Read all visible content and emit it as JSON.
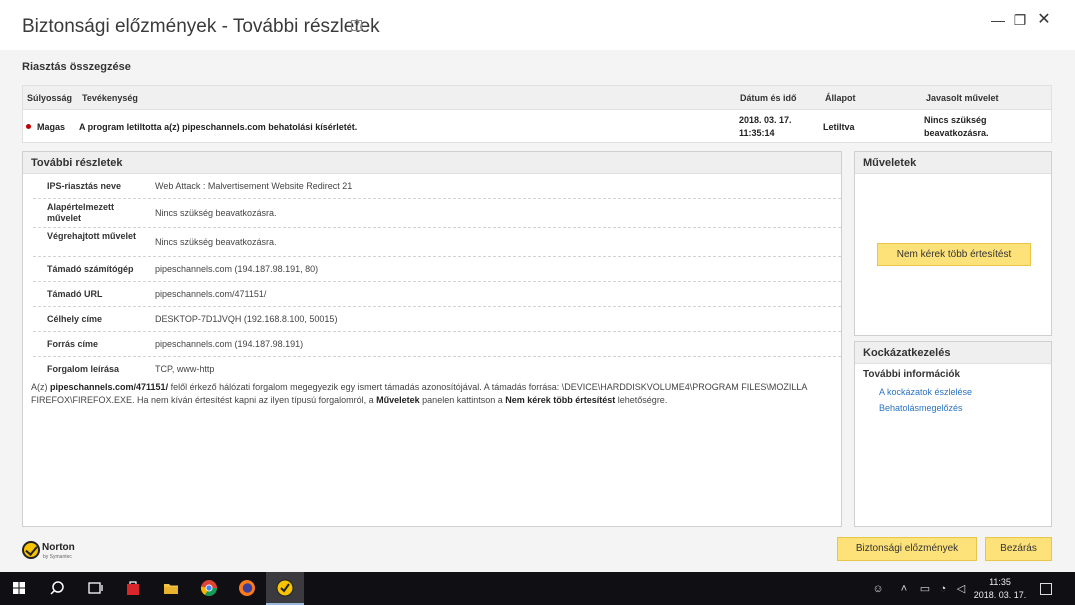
{
  "window": {
    "title": "Biztonsági előzmények - További részletek",
    "help": "?",
    "minimize": "—",
    "maximize": "❐",
    "close": "✕"
  },
  "summary": {
    "heading": "Riasztás összegzése",
    "columns": [
      "Súlyosság",
      "Tevékenység",
      "Dátum és idő",
      "Állapot",
      "Javasolt művelet"
    ],
    "row": {
      "severity": "Magas",
      "activity": "A program letiltotta a(z) pipeschannels.com behatolási kísérletét.",
      "date": "2018. 03. 17.",
      "time": "11:35:14",
      "status": "Letiltva",
      "action_line1": "Nincs szükség",
      "action_line2": "beavatkozásra."
    }
  },
  "details": {
    "heading": "További részletek",
    "rows": [
      {
        "label": "IPS-riasztás neve",
        "value": "Web Attack : Malvertisement Website Redirect 21"
      },
      {
        "label": "Alapértelmezett művelet",
        "value": "Nincs szükség beavatkozásra."
      },
      {
        "label": "Végrehajtott művelet",
        "value": "Nincs szükség beavatkozásra."
      },
      {
        "label": "Támadó számítógép",
        "value": "pipeschannels.com (194.187.98.191, 80)"
      },
      {
        "label": "Támadó URL",
        "value": "pipeschannels.com/471151/"
      },
      {
        "label": "Célhely címe",
        "value": "DESKTOP-7D1JVQH (192.168.8.100, 50015)"
      },
      {
        "label": "Forrás címe",
        "value": "pipeschannels.com (194.187.98.191)"
      },
      {
        "label": "Forgalom leírása",
        "value": "TCP, www-http"
      }
    ],
    "description": {
      "p1": "A(z) ",
      "b1": "pipeschannels.com/471151/",
      "p2": " felől érkező hálózati forgalom megegyezik egy ismert támadás azonosítójával. A támadás forrása: \\DEVICE\\HARDDISKVOLUME4\\PROGRAM FILES\\MOZILLA FIREFOX\\FIREFOX.EXE. Ha nem kíván értesítést kapni az ilyen típusú forgalomról, a ",
      "b2": "Műveletek",
      "p3": " panelen kattintson a ",
      "b3": "Nem kérek több értesítést",
      "p4": " lehetőségre."
    }
  },
  "actions": {
    "heading": "Műveletek",
    "button": "Nem kérek több értesítést"
  },
  "risk": {
    "heading": "Kockázatkezelés",
    "subheading": "További információk",
    "links": [
      "A kockázatok észlelése",
      "Behatolásmegelőzés"
    ]
  },
  "footer": {
    "brand": "Norton",
    "brand_sub": "by Symantec",
    "history_button": "Biztonsági előzmények",
    "close_button": "Bezárás"
  },
  "taskbar": {
    "time": "11:35",
    "date": "2018. 03. 17."
  },
  "colors": {
    "accent_yellow": "#fde27a",
    "severity_red": "#c00000",
    "link_blue": "#2a73c0"
  }
}
